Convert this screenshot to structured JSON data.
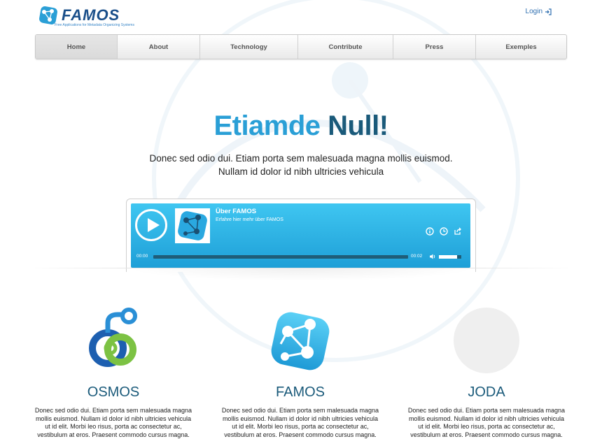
{
  "header": {
    "logo_text": "FAMOS",
    "logo_tagline": "Free Applications for Metadata Organizing Systems",
    "login_label": "Login"
  },
  "nav": {
    "items": [
      {
        "label": "Home",
        "active": true
      },
      {
        "label": "About",
        "active": false
      },
      {
        "label": "Technology",
        "active": false
      },
      {
        "label": "Contribute",
        "active": false
      },
      {
        "label": "Press",
        "active": false
      },
      {
        "label": "Exemples",
        "active": false
      }
    ]
  },
  "hero": {
    "title_part1": "Etiamde",
    "title_part2": "Null!",
    "subtitle_line1": "Donec sed odio dui. Etiam porta sem malesuada magna mollis euismod.",
    "subtitle_line2": "Nullam id dolor id nibh ultricies vehicula"
  },
  "player": {
    "title": "Über FAMOS",
    "subtitle": "Erfahre hier mehr über FAMOS",
    "time_elapsed": "00:00",
    "time_total": "00:02",
    "progress": 0,
    "volume": 0.8,
    "icons": [
      "info-icon",
      "clock-icon",
      "share-icon"
    ]
  },
  "columns": [
    {
      "title": "OSMOS",
      "text": "Donec sed odio dui. Etiam porta sem malesuada magna mollis euismod. Nullam id dolor id nibh ultricies vehicula ut id elit. Morbi leo risus, porta ac consectetur ac, vestibulum at eros. Praesent commodo cursus magna."
    },
    {
      "title": "FAMOS",
      "text": "Donec sed odio dui. Etiam porta sem malesuada magna mollis euismod. Nullam id dolor id nibh ultricies vehicula ut id elit. Morbi leo risus, porta ac consectetur ac, vestibulum at eros. Praesent commodo cursus magna."
    },
    {
      "title": "JODA",
      "text": "Donec sed odio dui. Etiam porta sem malesuada magna mollis euismod. Nullam id dolor id nibh ultricies vehicula ut id elit. Morbi leo risus, porta ac consectetur ac, vestibulum at eros. Praesent commodo cursus magna."
    }
  ],
  "colors": {
    "accent_blue": "#2a9fd6",
    "dark_teal": "#1a5a7a",
    "player_blue": "#3fc6f1",
    "osmos_green": "#7cc243"
  }
}
